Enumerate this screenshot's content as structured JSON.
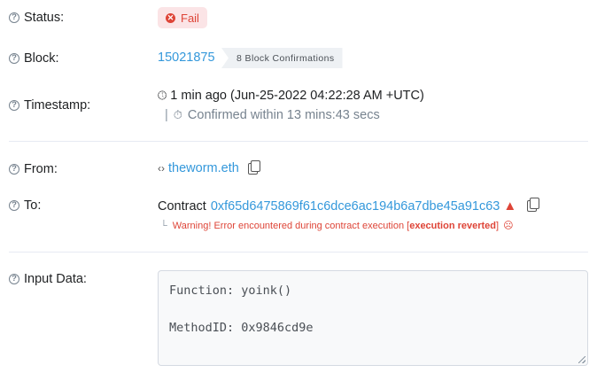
{
  "status": {
    "label": "Status:",
    "value": "Fail"
  },
  "block": {
    "label": "Block:",
    "number": "15021875",
    "confirmations": "8 Block Confirmations"
  },
  "timestamp": {
    "label": "Timestamp:",
    "value": "1 min ago (Jun-25-2022 04:22:28 AM +UTC)",
    "confirmed": "Confirmed within 13 mins:43 secs"
  },
  "from": {
    "label": "From:",
    "value": "theworm.eth"
  },
  "to": {
    "label": "To:",
    "prefix": "Contract",
    "address": "0xf65d6475869f61c6dce6ac194b6a7dbe45a91c63",
    "warning_prefix": "Warning! Error encountered during contract execution [",
    "warning_bold": "execution reverted",
    "warning_suffix": "]"
  },
  "input_data": {
    "label": "Input Data:",
    "function_line": "Function: yoink()",
    "method_line": "MethodID: 0x9846cd9e"
  },
  "colors": {
    "link": "#3498db",
    "fail": "#de4437"
  }
}
